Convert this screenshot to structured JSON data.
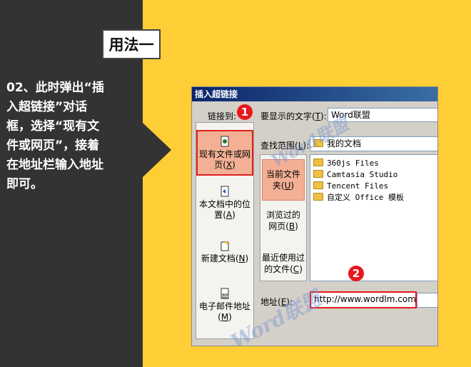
{
  "heading": "用法一",
  "instruction": "02、此时弹出“插\n入超链接”对话\n框，选择“现有文\n件或网页”，接着\n在地址栏输入地址\n即可。",
  "dialog": {
    "title": "插入超链接",
    "link_to_label": "链接到:",
    "display_text_label": "要显示的文字(",
    "display_text_key": "T",
    "display_text_label_end": "):",
    "display_text_value": "Word联盟",
    "lookin_label": "查找范围(",
    "lookin_key": "L",
    "lookin_label_end": "):",
    "lookin_value": "我的文档",
    "linkbar": [
      {
        "line1": "现有文件或网",
        "line2": "页(",
        "key": "X",
        "end": ")",
        "icon": "existing-file-icon"
      },
      {
        "line1": "本文档中的位",
        "line2": "置(",
        "key": "A",
        "end": ")",
        "icon": "place-in-document-icon"
      },
      {
        "line1": "新建文档(",
        "key": "N",
        "end": ")",
        "icon": "new-document-icon"
      },
      {
        "line1": "电子邮件地址",
        "line2": "(",
        "key": "M",
        "end": ")",
        "icon": "email-address-icon"
      }
    ],
    "subnav": [
      {
        "line1": "当前文件",
        "line2": "夹(",
        "key": "U",
        "end": ")"
      },
      {
        "line1": "浏览过的",
        "line2": "网页(",
        "key": "B",
        "end": ")"
      },
      {
        "line1": "最近使用过",
        "line2": "的文件(",
        "key": "C",
        "end": ")"
      }
    ],
    "files": [
      "360js Files",
      "Camtasia Studio",
      "Tencent Files",
      "自定义 Office 模板"
    ],
    "address_label": "地址(",
    "address_key": "E",
    "address_label_end": "):",
    "address_value": "http://www.wordlm.com/"
  },
  "markers": [
    "1",
    "2"
  ],
  "watermark": "Word联盟",
  "colors": {
    "accent_red": "#e8181c",
    "highlight": "#f4b095",
    "background": "#ffcd35",
    "dark_panel": "#333333"
  }
}
